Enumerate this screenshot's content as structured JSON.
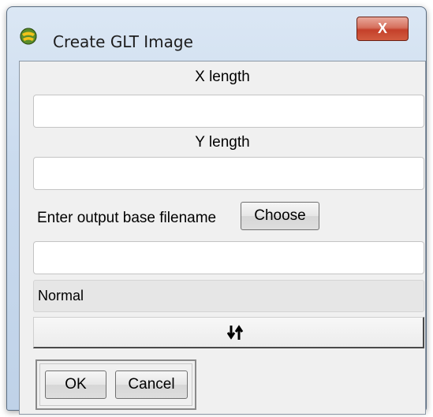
{
  "window": {
    "title": "Create GLT Image",
    "close_label": "X"
  },
  "form": {
    "x_length": {
      "label": "X length",
      "value": ""
    },
    "y_length": {
      "label": "Y length",
      "value": ""
    },
    "output": {
      "label": "Enter output base filename",
      "choose_label": "Choose",
      "value": ""
    },
    "status_text": "Normal",
    "sort_icon": "sort-up-down-icon"
  },
  "buttons": {
    "ok_label": "OK",
    "cancel_label": "Cancel"
  },
  "colors": {
    "close_button": "#c4402a",
    "title_bar": "#c9daee",
    "client_background": "#f0f0f0"
  }
}
